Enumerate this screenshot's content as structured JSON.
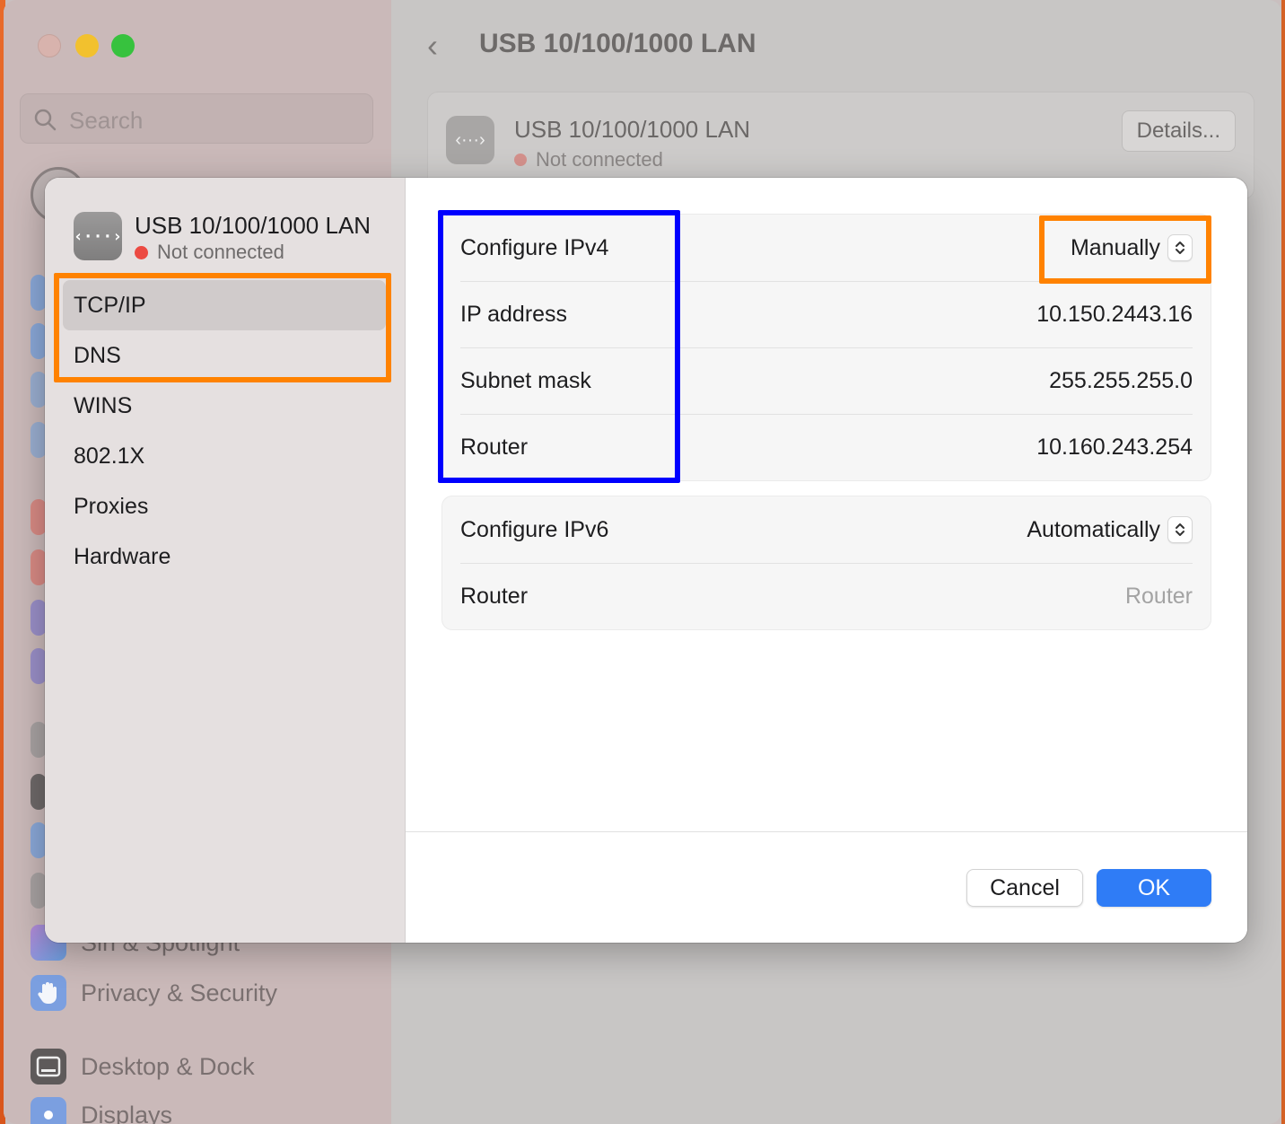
{
  "background": {
    "search": {
      "placeholder": "Search"
    },
    "sidebar_items": [
      "Privacy & Security",
      "Desktop & Dock",
      "Displays",
      "Siri & Spotlight"
    ],
    "page_title": "USB 10/100/1000 LAN",
    "card": {
      "name": "USB 10/100/1000 LAN",
      "status": "Not connected",
      "details_label": "Details..."
    }
  },
  "sheet": {
    "connection": {
      "icon_text": "‹···›",
      "name": "USB 10/100/1000 LAN",
      "status": "Not connected"
    },
    "nav": [
      {
        "label": "TCP/IP",
        "selected": true
      },
      {
        "label": "DNS"
      },
      {
        "label": "WINS"
      },
      {
        "label": "802.1X"
      },
      {
        "label": "Proxies"
      },
      {
        "label": "Hardware"
      }
    ],
    "ipv4": {
      "configure_label": "Configure IPv4",
      "configure_value": "Manually",
      "ip_label": "IP address",
      "ip_value": "10.150.2443.16",
      "subnet_label": "Subnet mask",
      "subnet_value": "255.255.255.0",
      "router_label": "Router",
      "router_value": "10.160.243.254"
    },
    "ipv6": {
      "configure_label": "Configure IPv6",
      "configure_value": "Automatically",
      "router_label": "Router",
      "router_placeholder": "Router"
    },
    "buttons": {
      "cancel": "Cancel",
      "ok": "OK"
    }
  },
  "colors": {
    "accent": "#2f7cf6",
    "annotation_orange": "#ff8200",
    "annotation_blue": "#0000ff",
    "status_red": "#ec4a42"
  }
}
